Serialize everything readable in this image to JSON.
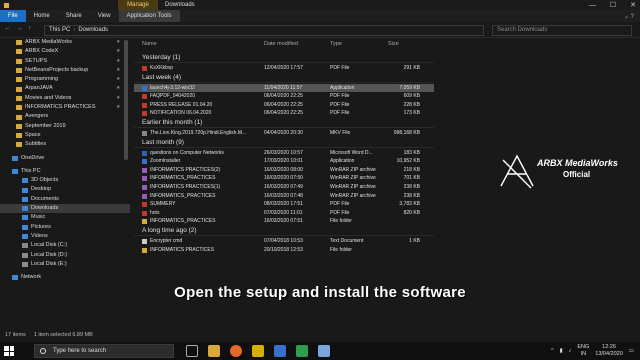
{
  "window": {
    "manage_label": "Manage",
    "title": "Downloads",
    "min": "—",
    "max": "☐",
    "close": "✕"
  },
  "ribbon": {
    "file": "File",
    "home": "Home",
    "share": "Share",
    "view": "View",
    "app_tools": "Application Tools",
    "right": "⌄ ?"
  },
  "address": {
    "back": "←",
    "forward": "→",
    "up": "↑",
    "crumb_1": "This PC",
    "crumb_2": "Downloads",
    "search_placeholder": "Search Downloads"
  },
  "sidebar": {
    "items": [
      {
        "label": "ARBX MediaWorks",
        "pin": "★"
      },
      {
        "label": "ARBX CodeX",
        "pin": "★"
      },
      {
        "label": "SETUPS",
        "pin": "★"
      },
      {
        "label": "NetBeansProjects backup",
        "pin": "★"
      },
      {
        "label": "Programming",
        "pin": "★"
      },
      {
        "label": "ArpanJAVA",
        "pin": "★"
      },
      {
        "label": "Movies and Videos",
        "pin": "★"
      },
      {
        "label": "INFORMATICS PRACTICES",
        "pin": "★"
      },
      {
        "label": "Avengers",
        "pin": ""
      },
      {
        "label": "September 2019",
        "pin": ""
      },
      {
        "label": "Space",
        "pin": ""
      },
      {
        "label": "Subtitles",
        "pin": ""
      }
    ],
    "onedrive": "OneDrive",
    "thispc": "This PC",
    "pc_items": [
      "3D Objects",
      "Desktop",
      "Documents",
      "Downloads",
      "Music",
      "Pictures",
      "Videos",
      "Local Disk (C:)",
      "Local Disk (D:)",
      "Local Disk (E:)"
    ],
    "network": "Network"
  },
  "columns": {
    "name": "Name",
    "date": "Date modified",
    "type": "Type",
    "size": "Size"
  },
  "groups": [
    {
      "title": "Yesterday (1)",
      "rows": [
        {
          "icon": "pdf",
          "name": "KsXKkbvp",
          "date": "12/04/2020 17:57",
          "type": "PDF File",
          "size": "291 KB"
        }
      ]
    },
    {
      "title": "Last week (4)",
      "rows": [
        {
          "icon": "app",
          "name": "launch4j-3.12-win32",
          "date": "11/04/2020 11:57",
          "type": "Application",
          "size": "7,059 KB",
          "selected": true
        },
        {
          "icon": "pdf",
          "name": "FAQPDF_04042020",
          "date": "06/04/2020 22:25",
          "type": "PDF File",
          "size": "609 KB"
        },
        {
          "icon": "pdf",
          "name": "PRESS RELEASE 01.04.20",
          "date": "06/04/2020 22:25",
          "type": "PDF File",
          "size": "228 KB"
        },
        {
          "icon": "pdf",
          "name": "NOTIFICATION 06.04.2020",
          "date": "06/04/2020 22:25",
          "type": "PDF File",
          "size": "173 KB"
        }
      ]
    },
    {
      "title": "Earlier this month (1)",
      "rows": [
        {
          "icon": "mkv",
          "name": "The.Lion.King.2019.720p.Hindi.English.M...",
          "date": "04/04/2020 20:30",
          "type": "MKV File",
          "size": "998,168 KB"
        }
      ]
    },
    {
      "title": "Last month (9)",
      "rows": [
        {
          "icon": "word",
          "name": "questions on Computer Networks",
          "date": "26/03/2020 10:57",
          "type": "Microsoft Word D...",
          "size": "183 KB"
        },
        {
          "icon": "app",
          "name": "ZoomInstaller",
          "date": "17/03/2020 10:01",
          "type": "Application",
          "size": "10,952 KB"
        },
        {
          "icon": "zip",
          "name": "INFORMATICS PRACTICES(2)",
          "date": "16/03/2020 08:00",
          "type": "WinRAR ZIP archive",
          "size": "218 KB"
        },
        {
          "icon": "zip",
          "name": "INFORMATICS_PRACTICES",
          "date": "16/03/2020 07:50",
          "type": "WinRAR ZIP archive",
          "size": "701 KB"
        },
        {
          "icon": "zip",
          "name": "INFORMATICS PRACTICES(1)",
          "date": "16/03/2020 07:49",
          "type": "WinRAR ZIP archive",
          "size": "238 KB"
        },
        {
          "icon": "zip",
          "name": "INFORMATICS_PRACTICES",
          "date": "16/03/2020 07:48",
          "type": "WinRAR ZIP archive",
          "size": "238 KB"
        },
        {
          "icon": "pdf",
          "name": "SUMMERY",
          "date": "08/03/2020 17:51",
          "type": "PDF File",
          "size": "3,783 KB"
        },
        {
          "icon": "pdf",
          "name": "hots",
          "date": "07/03/2020 11:01",
          "type": "PDF File",
          "size": "820 KB"
        },
        {
          "icon": "fold",
          "name": "INFORMATICS_PRACTICES",
          "date": "16/03/2020 07:51",
          "type": "File folder",
          "size": ""
        }
      ]
    },
    {
      "title": "A long time ago (2)",
      "rows": [
        {
          "icon": "txt",
          "name": "Encrypter cmd",
          "date": "07/04/2018 10:53",
          "type": "Text Document",
          "size": "1 KB"
        },
        {
          "icon": "fold",
          "name": "INFORMATICS PRACTICES",
          "date": "20/10/2018 12:53",
          "type": "File folder",
          "size": ""
        }
      ]
    }
  ],
  "logo": {
    "line1": "ARBX MediaWorks",
    "line2": "Official"
  },
  "caption": "Open the setup and install the software",
  "status": {
    "count": "17 items",
    "selected": "1 item selected  6.89 MB"
  },
  "taskbar": {
    "search_placeholder": "Type here to search",
    "lang": "ENG",
    "region": "IN",
    "time": "12:26",
    "date": "13/04/2020"
  },
  "colors": {
    "accent": "#1b6fc6",
    "manage": "#4b3b12"
  }
}
